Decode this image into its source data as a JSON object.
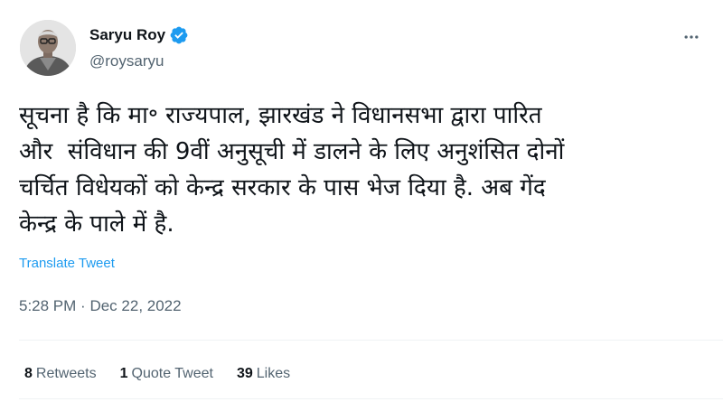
{
  "author": {
    "display_name": "Saryu Roy",
    "handle": "@roysaryu",
    "verified_icon": "verified-badge-icon",
    "avatar_icon": "profile-photo"
  },
  "tweet": {
    "text_lines": [
      "सूचना है कि मा॰ राज्यपाल, झारखंड ने विधानसभा द्वारा पारित",
      "और  संविधान की 9वीं अनुसूची में डालने के लिए अनुशंसित दोनों",
      "चर्चित विधेयकों को केन्द्र सरकार के पास भेज दिया है. अब गेंद",
      "केन्द्र के पाले में है."
    ],
    "translate_label": "Translate Tweet",
    "time": "5:28 PM",
    "separator": "·",
    "date": "Dec 22, 2022"
  },
  "stats": {
    "retweets_count": "8",
    "retweets_label": "Retweets",
    "quotes_count": "1",
    "quotes_label": "Quote Tweet",
    "likes_count": "39",
    "likes_label": "Likes"
  },
  "colors": {
    "accent": "#1d9bf0",
    "text": "#0f1419",
    "secondary": "#536471",
    "divider": "#eff3f4"
  },
  "icons": {
    "more": "more-horizontal-icon"
  }
}
